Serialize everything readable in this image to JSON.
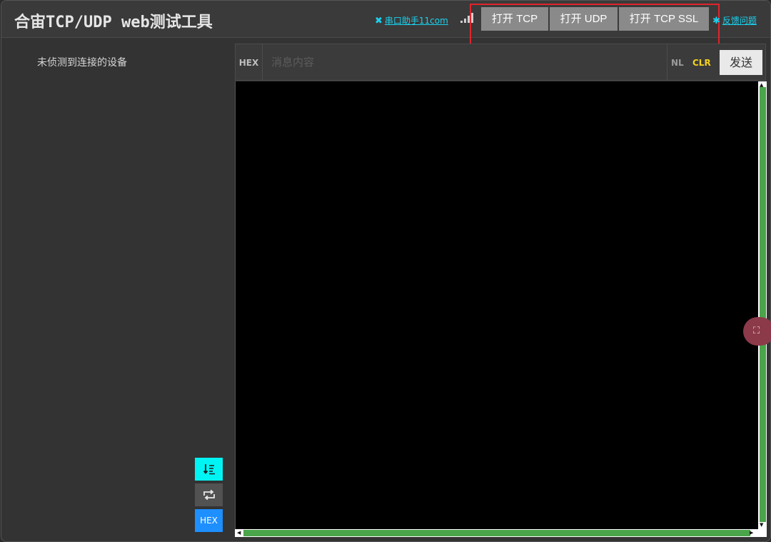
{
  "app": {
    "title": "合宙TCP/UDP web测试工具"
  },
  "topbar": {
    "serial_link": "串口助手11com",
    "open_tcp": "打开 TCP",
    "open_udp": "打开 UDP",
    "open_tcp_ssl": "打开 TCP SSL",
    "feedback_link": "反馈问题"
  },
  "sidebar": {
    "status": "未侦测到连接的设备",
    "hex_toggle": "HEX"
  },
  "message_bar": {
    "hex_label": "HEX",
    "placeholder": "消息内容",
    "nl_label": "NL",
    "clr_label": "CLR",
    "send_label": "发送"
  },
  "colors": {
    "accent_cyan": "#19d3f0",
    "hex_blue": "#1e8fff",
    "scroll_green": "#4aa44a",
    "highlight_red": "#e0242b",
    "clr_yellow": "#f5d21e"
  }
}
